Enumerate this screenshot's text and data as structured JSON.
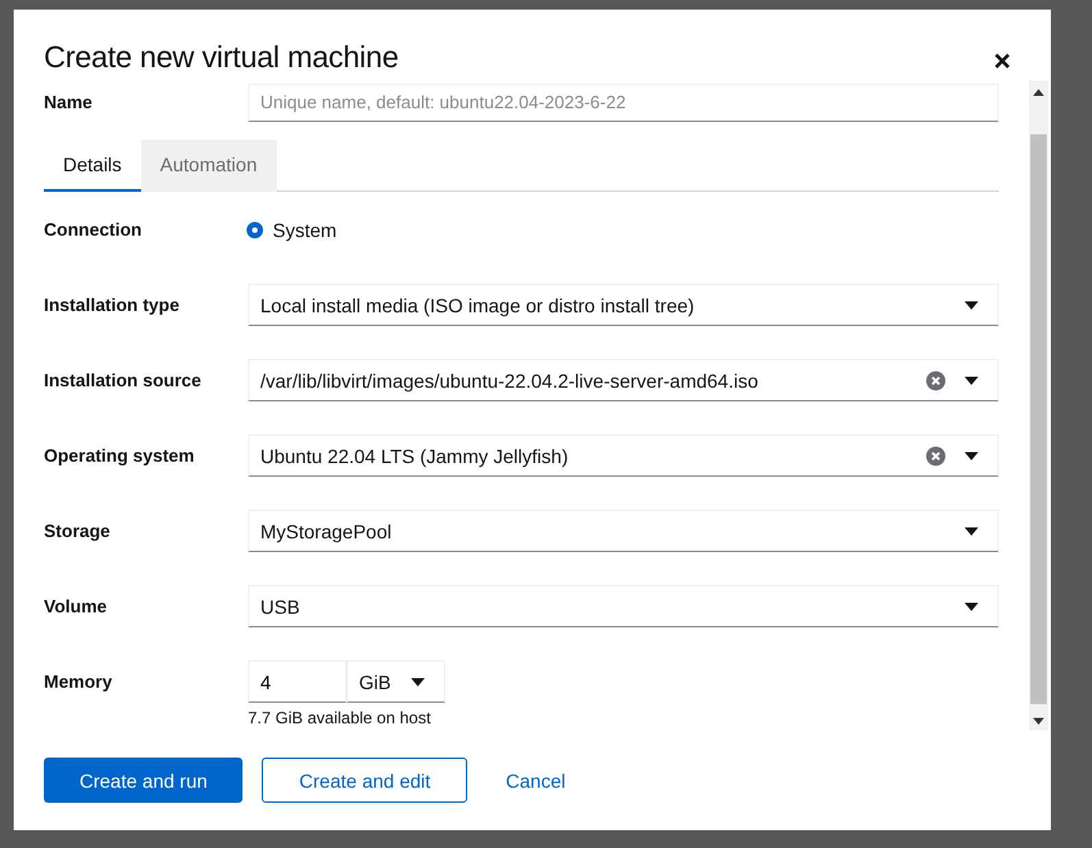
{
  "dialog": {
    "title": "Create new virtual machine"
  },
  "name_field": {
    "label": "Name",
    "placeholder": "Unique name, default: ubuntu22.04-2023-6-22"
  },
  "tabs": [
    {
      "label": "Details",
      "selected": true
    },
    {
      "label": "Automation",
      "selected": false
    }
  ],
  "fields": [
    {
      "kind": "radio",
      "label": "Connection",
      "value": "System",
      "checked": true
    },
    {
      "kind": "select",
      "label": "Installation type",
      "value": "Local install media (ISO image or distro install tree)",
      "clearable": false
    },
    {
      "kind": "select",
      "label": "Installation source",
      "value": "/var/lib/libvirt/images/ubuntu-22.04.2-live-server-amd64.iso",
      "clearable": true
    },
    {
      "kind": "select",
      "label": "Operating system",
      "value": "Ubuntu 22.04 LTS (Jammy Jellyfish)",
      "clearable": true
    },
    {
      "kind": "select",
      "label": "Storage",
      "value": "MyStoragePool",
      "clearable": false
    },
    {
      "kind": "select",
      "label": "Volume",
      "value": "USB",
      "clearable": false
    },
    {
      "kind": "memory",
      "label": "Memory",
      "value": "4",
      "unit": "GiB",
      "helper": "7.7 GiB available on host"
    }
  ],
  "buttons": [
    {
      "kind": "primary",
      "label": "Create and run"
    },
    {
      "kind": "secondary",
      "label": "Create and edit"
    },
    {
      "kind": "link",
      "label": "Cancel"
    }
  ]
}
